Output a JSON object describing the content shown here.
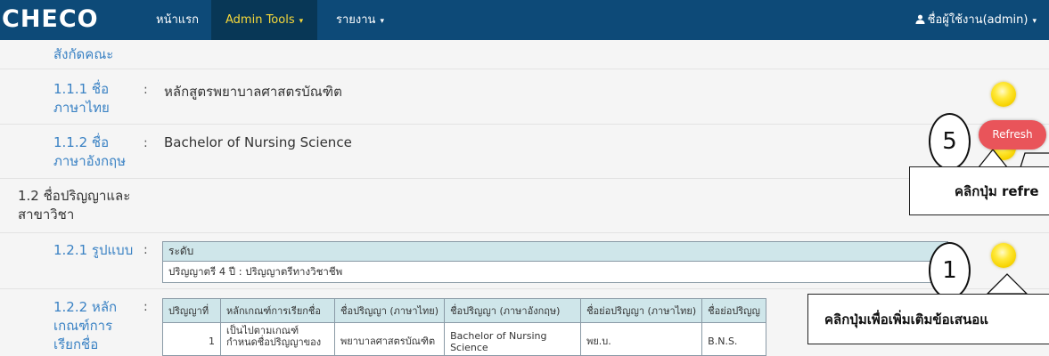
{
  "navbar": {
    "brand": "CHECO",
    "home": "หน้าแรก",
    "admin_tools": "Admin Tools",
    "reports": "รายงาน",
    "user": "ชื่อผู้ใช้งาน(admin)",
    "caret": "▾"
  },
  "rows": {
    "faculty_label": "สังกัดคณะ",
    "r111_label": "1.1.1 ชื่อ ภาษาไทย",
    "r111_value": "หลักสูตรพยาบาลศาสตรบัณฑิต",
    "r112_label": "1.1.2 ชื่อ ภาษาอังกฤษ",
    "r112_value": "Bachelor of Nursing Science",
    "s12_label": "1.2 ชื่อปริญญาและ สาขาวิชา",
    "r121_label": "1.2.1 รูปแบบ",
    "r122_label": "1.2.2 หลัก เกณฑ์การ เรียกชื่อ",
    "colon": ":"
  },
  "level_box": {
    "header": "ระดับ",
    "value": "ปริญญาตรี 4 ปี : ปริญญาตรีทางวิชาชีพ"
  },
  "degree_table": {
    "headers": [
      "ปริญญาที่",
      "หลักเกณฑ์การเรียกชื่อ",
      "ชื่อปริญญา (ภาษาไทย)",
      "ชื่อปริญญา (ภาษาอังกฤษ)",
      "ชื่อย่อปริญญา (ภาษาไทย)",
      "ชื่อย่อปริญญ"
    ],
    "row": [
      "1",
      "เป็นไปตามเกณฑ์ กำหนดชื่อปริญญาของ",
      "พยาบาลศาสตรบัณฑิต",
      "Bachelor of Nursing Science",
      "พย.บ.",
      "B.N.S."
    ]
  },
  "annotations": {
    "step5": "5",
    "step1": "1",
    "refresh_button": "Refresh",
    "callout_refresh": "คลิกปุ่ม refre",
    "callout_add": "คลิกปุ่มเพื่อเพิ่มเติมข้อเสนอแ"
  },
  "colors": {
    "navbar": "#0d4a78",
    "active_tab_text": "#f8d93a",
    "label_blue": "#3a82c4",
    "refresh": "#e9545a",
    "bulb": "#f7d300"
  }
}
